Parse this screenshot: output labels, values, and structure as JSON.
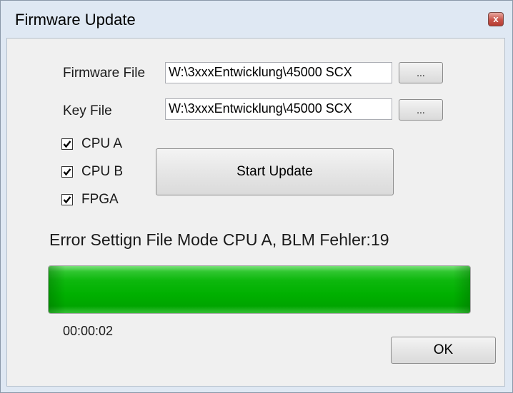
{
  "window": {
    "title": "Firmware Update",
    "close_label": "x"
  },
  "form": {
    "firmware_label": "Firmware File",
    "firmware_value": "W:\\3xxxEntwicklung\\45000 SCX",
    "key_label": "Key File",
    "key_value": "W:\\3xxxEntwicklung\\45000 SCX",
    "browse_label": "..."
  },
  "options": [
    {
      "label": "CPU A",
      "checked": true
    },
    {
      "label": "CPU B",
      "checked": true
    },
    {
      "label": "FPGA",
      "checked": true
    }
  ],
  "start_button": "Start Update",
  "status_text": "Error Settign File Mode CPU A, BLM Fehler:19",
  "progress": {
    "percent": 100,
    "color": "#00b000"
  },
  "elapsed": "00:00:02",
  "ok_button": "OK"
}
